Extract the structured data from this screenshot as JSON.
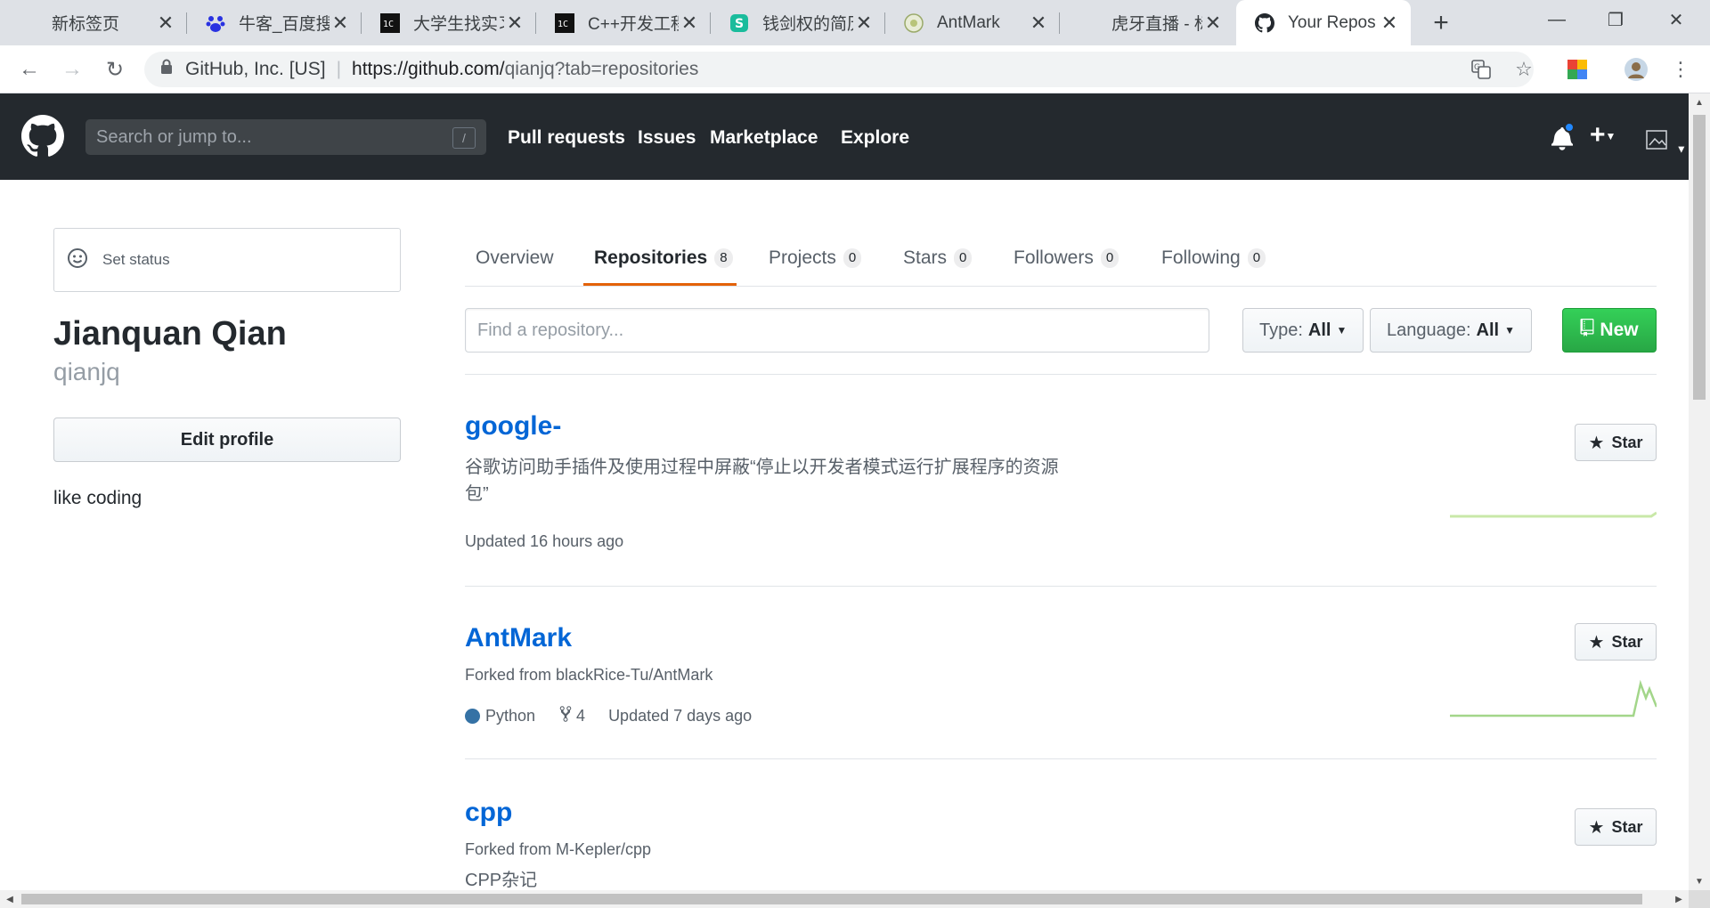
{
  "browser": {
    "tabs": [
      {
        "title": "新标签页",
        "icon": "blank-page-icon",
        "active": false
      },
      {
        "title": "牛客_百度搜",
        "icon": "baidu-paw-icon",
        "active": false
      },
      {
        "title": "大学生找实习",
        "icon": "site-favicon-dark",
        "active": false
      },
      {
        "title": "C++开发工程",
        "icon": "site-favicon-dark",
        "active": false
      },
      {
        "title": "钱剑权的简历",
        "icon": "resume-site-icon",
        "active": false
      },
      {
        "title": "AntMark",
        "icon": "antmark-favicon",
        "active": false
      },
      {
        "title": "虎牙直播 - 标",
        "icon": "huya-favicon",
        "active": false
      },
      {
        "title": "Your Repos",
        "icon": "github-icon",
        "active": true
      }
    ],
    "url": {
      "org": "GitHub, Inc. [US]",
      "host": "https://github.com/",
      "path": "qianjq?tab=repositories"
    }
  },
  "gh": {
    "search_placeholder": "Search or jump to...",
    "search_hotkey": "/",
    "nav": [
      "Pull requests",
      "Issues",
      "Marketplace",
      "Explore"
    ]
  },
  "profile": {
    "set_status": "Set status",
    "fullname": "Jianquan Qian",
    "username": "qianjq",
    "edit_profile": "Edit profile",
    "bio": "like coding"
  },
  "tabs": [
    {
      "label": "Overview",
      "count": null,
      "selected": false
    },
    {
      "label": "Repositories",
      "count": "8",
      "selected": true
    },
    {
      "label": "Projects",
      "count": "0",
      "selected": false
    },
    {
      "label": "Stars",
      "count": "0",
      "selected": false
    },
    {
      "label": "Followers",
      "count": "0",
      "selected": false
    },
    {
      "label": "Following",
      "count": "0",
      "selected": false
    }
  ],
  "filters": {
    "find_placeholder": "Find a repository...",
    "type_label": "Type:",
    "type_value": "All",
    "language_label": "Language:",
    "language_value": "All",
    "new_label": "New"
  },
  "repos": [
    {
      "name": "google-",
      "description_line1": "谷歌访问助手插件及使用过程中屏蔽“停止以开发者模式运行扩展程序的资源",
      "description_line2": "包”",
      "updated": "Updated 16 hours ago",
      "star_label": "Star"
    },
    {
      "name": "AntMark",
      "forked_from": "Forked from blackRice-Tu/AntMark",
      "language": "Python",
      "language_color": "#3572a5",
      "forks": "4",
      "updated": "Updated 7 days ago",
      "star_label": "Star"
    },
    {
      "name": "cpp",
      "forked_from": "Forked from M-Kepler/cpp",
      "description": "CPP杂记",
      "star_label": "Star"
    }
  ],
  "colors": {
    "header_bg": "#24292e",
    "link_blue": "#0366d6",
    "new_button_green": "#28a745",
    "selected_tab_underline": "#e36209",
    "spark_line": "#c9e8a8"
  }
}
